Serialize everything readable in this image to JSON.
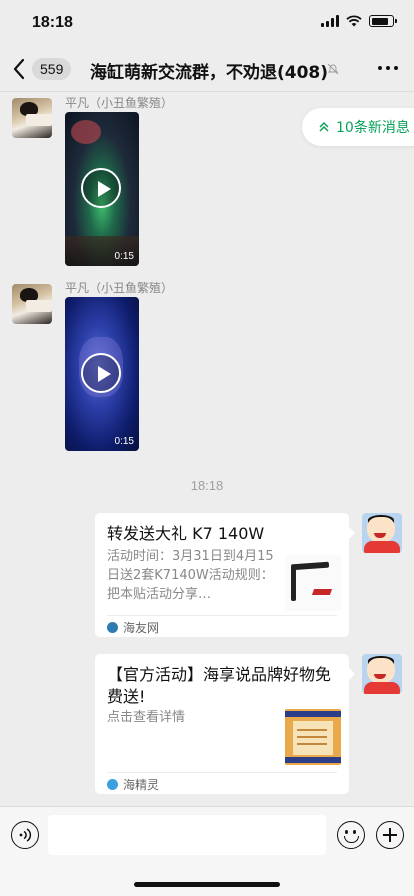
{
  "status_bar": {
    "time": "18:18"
  },
  "nav": {
    "unread_count": "559",
    "title": "海缸萌新交流群，不劝退(408)"
  },
  "new_messages": {
    "label": "10条新消息"
  },
  "messages": [
    {
      "sender": "平凡（小丑鱼繁殖）",
      "type": "video",
      "duration": "0:15"
    },
    {
      "sender": "平凡（小丑鱼繁殖）",
      "type": "video",
      "duration": "0:15"
    }
  ],
  "time_divider": "18:18",
  "cards": [
    {
      "title": "转发送大礼 K7 140W",
      "description": "活动时间：3月31日到4月15日送2套K7140W活动规则：把本贴活动分享…",
      "source": "海友网",
      "source_color": "#2e7bb0"
    },
    {
      "title": "【官方活动】海享说品牌好物免费送!",
      "description": "点击查看详情",
      "source": "海精灵",
      "source_color": "#3aa0e0"
    }
  ],
  "input": {
    "value": ""
  },
  "colors": {
    "accent": "#07a25a",
    "background": "#ededed"
  }
}
